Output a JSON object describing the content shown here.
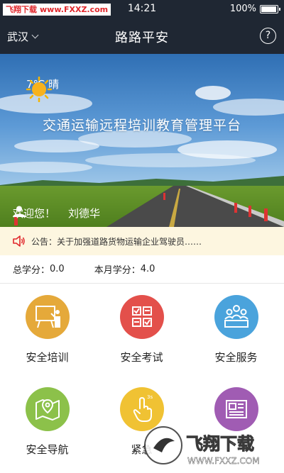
{
  "status_bar": {
    "watermark_text": "飞翔下载",
    "watermark_url": "www.FXXZ.com",
    "time": "14:21",
    "battery": "100%",
    "battery_level": 1.0
  },
  "nav": {
    "city": "武汉",
    "title": "路路平安",
    "help_icon": "?"
  },
  "banner": {
    "temperature": "7℃",
    "condition": "晴",
    "title": "交通运输远程培训教育管理平台",
    "welcome": "欢迎您！",
    "user_name": "刘德华"
  },
  "notice": {
    "text": "公告：关于加强道路货物运输企业驾驶员……"
  },
  "credits": {
    "total_label": "总学分：",
    "total_value": "0.0",
    "month_label": "本月学分：",
    "month_value": "4.0"
  },
  "grid": [
    {
      "label": "安全培训",
      "icon": "training-board-icon",
      "color": "#e5a93a"
    },
    {
      "label": "安全考试",
      "icon": "exam-checklist-icon",
      "color": "#e3504b"
    },
    {
      "label": "安全服务",
      "icon": "service-meeting-icon",
      "color": "#4aa3dc"
    },
    {
      "label": "安全导航",
      "icon": "map-pin-icon",
      "color": "#8cc14a"
    },
    {
      "label": "紧急",
      "icon": "tap-finger-icon",
      "color": "#f0c233"
    },
    {
      "label": "",
      "icon": "news-document-icon",
      "color": "#a05cb3"
    }
  ],
  "watermark_logo": {
    "main": "飞翔下载",
    "url": "WWW.FXXZ.COM"
  }
}
